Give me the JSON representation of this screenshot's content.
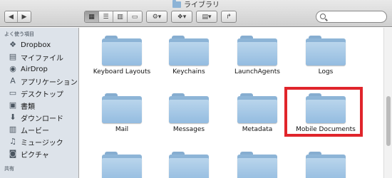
{
  "window": {
    "title": "ライブラリ"
  },
  "toolbar": {
    "back_icon": "back-arrow-icon",
    "forward_icon": "forward-arrow-icon",
    "view_buttons": [
      "icon-view",
      "list-view",
      "column-view",
      "coverflow-view"
    ],
    "action_icon": "gear-icon",
    "dropbox_icon": "dropbox-icon",
    "arrange_icon": "arrange-icon",
    "share_icon": "share-icon",
    "search_placeholder": ""
  },
  "sidebar": {
    "favorites_heading": "よく使う項目",
    "shared_heading": "共有",
    "items": [
      {
        "label": "Dropbox",
        "icon": "dropbox-icon"
      },
      {
        "label": "マイファイル",
        "icon": "files-icon"
      },
      {
        "label": "AirDrop",
        "icon": "airdrop-icon"
      },
      {
        "label": "アプリケーション",
        "icon": "applications-icon"
      },
      {
        "label": "デスクトップ",
        "icon": "desktop-icon"
      },
      {
        "label": "書類",
        "icon": "documents-icon"
      },
      {
        "label": "ダウンロード",
        "icon": "download-icon"
      },
      {
        "label": "ムービー",
        "icon": "movies-icon"
      },
      {
        "label": "ミュージック",
        "icon": "music-icon"
      },
      {
        "label": "ピクチャ",
        "icon": "pictures-icon"
      }
    ]
  },
  "folders": [
    "Keyboard Layouts",
    "Keychains",
    "LaunchAgents",
    "Logs",
    "Mail",
    "Messages",
    "Metadata",
    "Mobile Documents",
    "",
    "",
    "",
    ""
  ],
  "highlighted_folder": "Mobile Documents",
  "colors": {
    "highlight": "#e0252b",
    "folder": "#94bce0",
    "sidebar": "#dde3ea"
  }
}
